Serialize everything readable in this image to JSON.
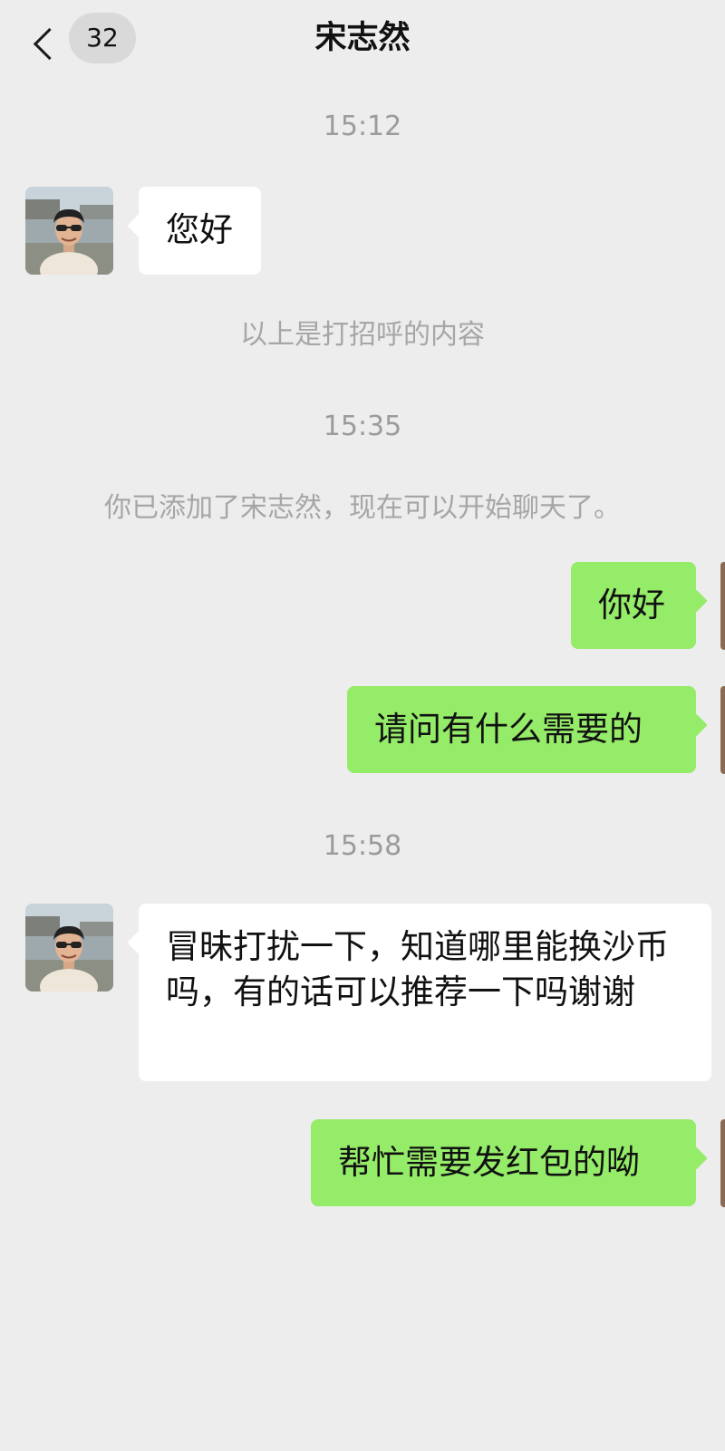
{
  "header": {
    "back_label": "",
    "unread_count": "32",
    "title": "宋志然"
  },
  "messages": [
    {
      "kind": "time",
      "text": "15:12"
    },
    {
      "kind": "incoming",
      "text": "您好"
    },
    {
      "kind": "system",
      "text": "以上是打招呼的内容"
    },
    {
      "kind": "time",
      "text": "15:35"
    },
    {
      "kind": "system",
      "text": "你已添加了宋志然，现在可以开始聊天了。"
    },
    {
      "kind": "outgoing",
      "text": "你好"
    },
    {
      "kind": "outgoing",
      "text": "请问有什么需要的"
    },
    {
      "kind": "time",
      "text": "15:58"
    },
    {
      "kind": "incoming",
      "text": "冒昧打扰一下，知道哪里能换沙币吗，有的话可以推荐一下吗谢谢"
    },
    {
      "kind": "outgoing",
      "text": "帮忙需要发红包的呦"
    }
  ],
  "colors": {
    "background": "#ededed",
    "outgoing_bubble": "#95ec69",
    "incoming_bubble": "#ffffff",
    "timestamp_text": "#9b9b9b",
    "unread_badge": "#d9d9d9"
  }
}
